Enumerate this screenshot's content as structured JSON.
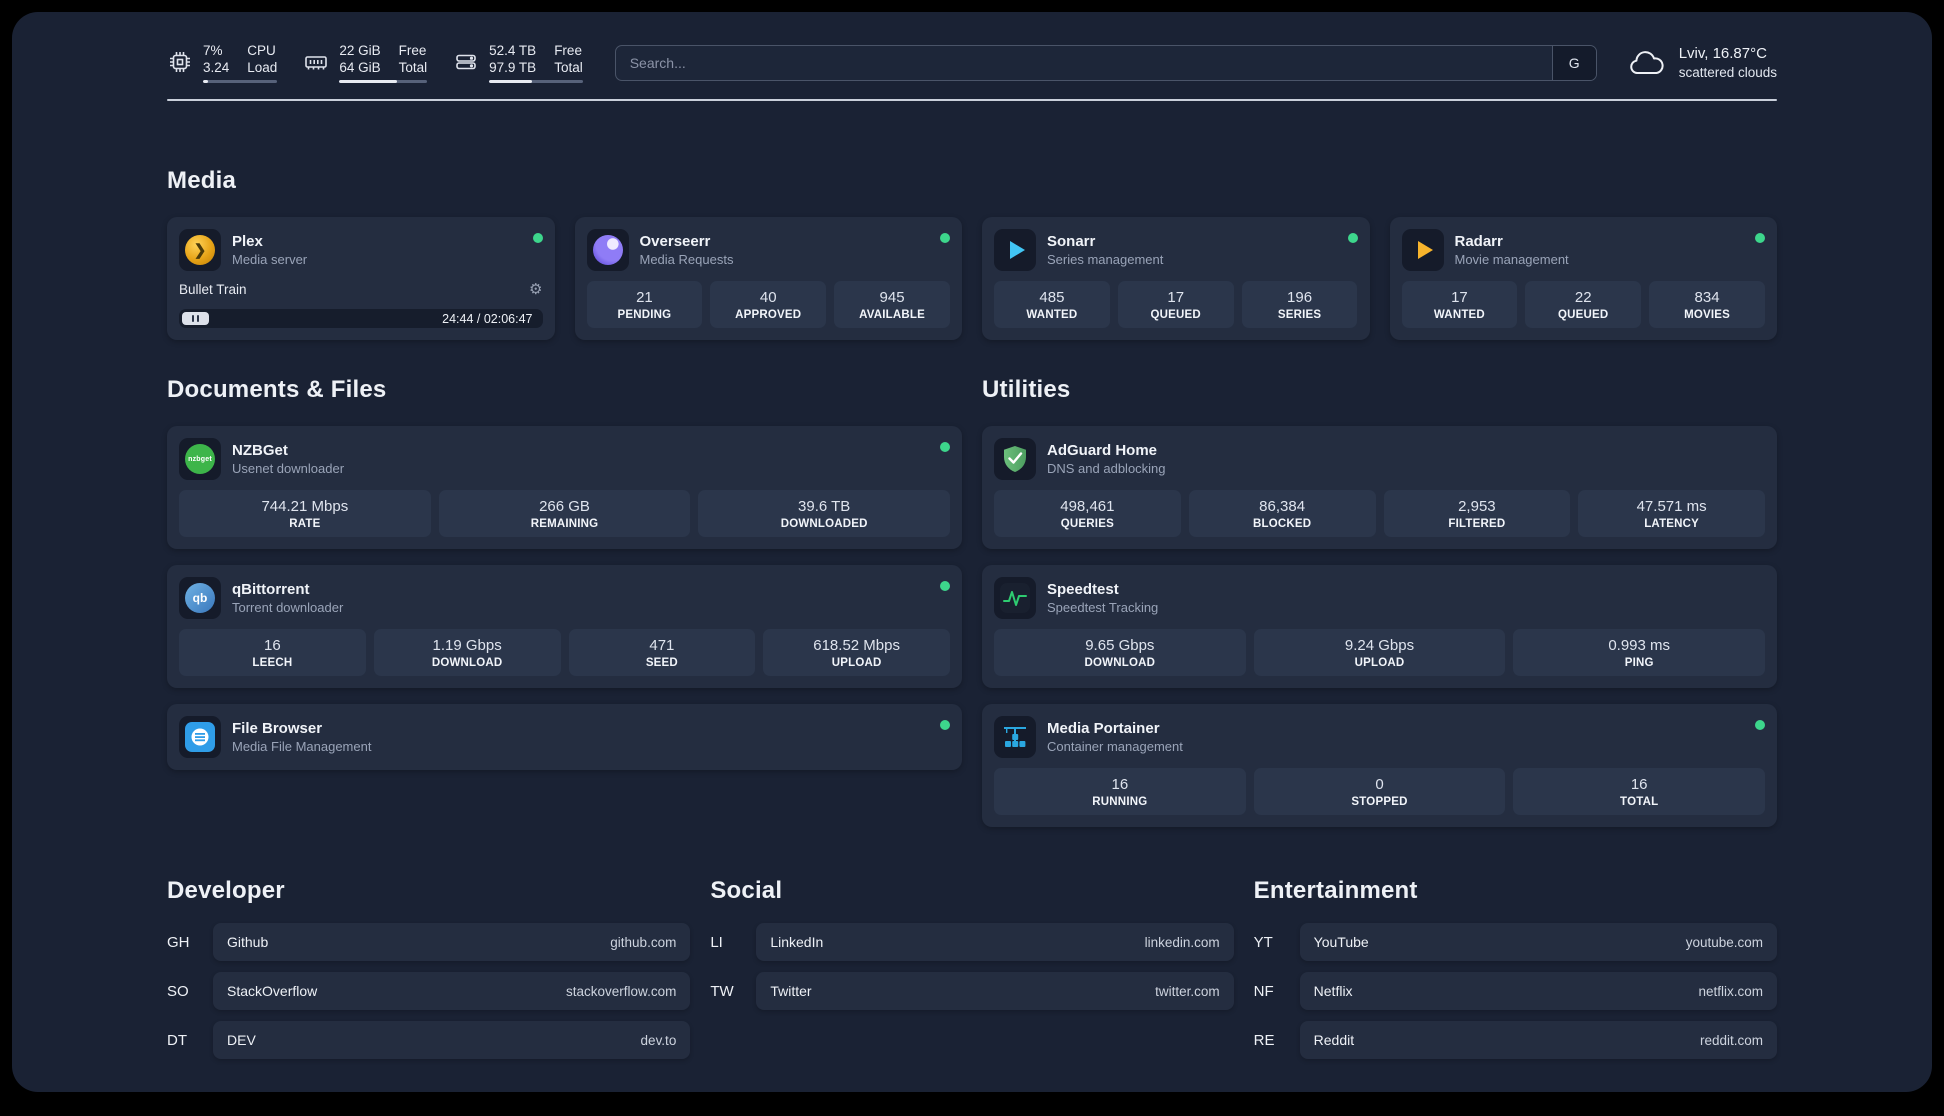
{
  "topbar": {
    "cpu": {
      "value_top": "7%",
      "value_bottom": "3.24",
      "label_top": "CPU",
      "label_bottom": "Load",
      "bar_percent": 7
    },
    "ram": {
      "value_top": "22 GiB",
      "value_bottom": "64 GiB",
      "label_top": "Free",
      "label_bottom": "Total",
      "bar_percent": 66
    },
    "disk": {
      "value_top": "52.4 TB",
      "value_bottom": "97.9 TB",
      "label_top": "Free",
      "label_bottom": "Total",
      "bar_percent": 46
    },
    "search": {
      "placeholder": "Search...",
      "button_label": "G"
    },
    "weather": {
      "location": "Lviv, 16.87°C",
      "condition": "scattered clouds"
    }
  },
  "sections": {
    "media": {
      "title": "Media",
      "plex": {
        "name": "Plex",
        "subtitle": "Media server",
        "now_playing": "Bullet Train",
        "time": "24:44 / 02:06:47"
      },
      "overseerr": {
        "name": "Overseerr",
        "subtitle": "Media Requests",
        "stats": [
          {
            "value": "21",
            "label": "PENDING"
          },
          {
            "value": "40",
            "label": "APPROVED"
          },
          {
            "value": "945",
            "label": "AVAILABLE"
          }
        ]
      },
      "sonarr": {
        "name": "Sonarr",
        "subtitle": "Series management",
        "stats": [
          {
            "value": "485",
            "label": "WANTED"
          },
          {
            "value": "17",
            "label": "QUEUED"
          },
          {
            "value": "196",
            "label": "SERIES"
          }
        ]
      },
      "radarr": {
        "name": "Radarr",
        "subtitle": "Movie management",
        "stats": [
          {
            "value": "17",
            "label": "WANTED"
          },
          {
            "value": "22",
            "label": "QUEUED"
          },
          {
            "value": "834",
            "label": "MOVIES"
          }
        ]
      }
    },
    "files": {
      "title": "Documents & Files",
      "nzbget": {
        "name": "NZBGet",
        "subtitle": "Usenet downloader",
        "stats": [
          {
            "value": "744.21 Mbps",
            "label": "RATE"
          },
          {
            "value": "266 GB",
            "label": "REMAINING"
          },
          {
            "value": "39.6 TB",
            "label": "DOWNLOADED"
          }
        ]
      },
      "qbittorrent": {
        "name": "qBittorrent",
        "subtitle": "Torrent downloader",
        "stats": [
          {
            "value": "16",
            "label": "LEECH"
          },
          {
            "value": "1.19 Gbps",
            "label": "DOWNLOAD"
          },
          {
            "value": "471",
            "label": "SEED"
          },
          {
            "value": "618.52 Mbps",
            "label": "UPLOAD"
          }
        ]
      },
      "filebrowser": {
        "name": "File Browser",
        "subtitle": "Media File Management"
      }
    },
    "utilities": {
      "title": "Utilities",
      "adguard": {
        "name": "AdGuard Home",
        "subtitle": "DNS and adblocking",
        "stats": [
          {
            "value": "498,461",
            "label": "QUERIES"
          },
          {
            "value": "86,384",
            "label": "BLOCKED"
          },
          {
            "value": "2,953",
            "label": "FILTERED"
          },
          {
            "value": "47.571 ms",
            "label": "LATENCY"
          }
        ]
      },
      "speedtest": {
        "name": "Speedtest",
        "subtitle": "Speedtest Tracking",
        "stats": [
          {
            "value": "9.65 Gbps",
            "label": "DOWNLOAD"
          },
          {
            "value": "9.24 Gbps",
            "label": "UPLOAD"
          },
          {
            "value": "0.993 ms",
            "label": "PING"
          }
        ]
      },
      "portainer": {
        "name": "Media Portainer",
        "subtitle": "Container management",
        "stats": [
          {
            "value": "16",
            "label": "RUNNING"
          },
          {
            "value": "0",
            "label": "STOPPED"
          },
          {
            "value": "16",
            "label": "TOTAL"
          }
        ]
      }
    }
  },
  "bookmarks": {
    "developer": {
      "title": "Developer",
      "items": [
        {
          "abbr": "GH",
          "name": "Github",
          "domain": "github.com"
        },
        {
          "abbr": "SO",
          "name": "StackOverflow",
          "domain": "stackoverflow.com"
        },
        {
          "abbr": "DT",
          "name": "DEV",
          "domain": "dev.to"
        }
      ]
    },
    "social": {
      "title": "Social",
      "items": [
        {
          "abbr": "LI",
          "name": "LinkedIn",
          "domain": "linkedin.com"
        },
        {
          "abbr": "TW",
          "name": "Twitter",
          "domain": "twitter.com"
        }
      ]
    },
    "entertainment": {
      "title": "Entertainment",
      "items": [
        {
          "abbr": "YT",
          "name": "YouTube",
          "domain": "youtube.com"
        },
        {
          "abbr": "NF",
          "name": "Netflix",
          "domain": "netflix.com"
        },
        {
          "abbr": "RE",
          "name": "Reddit",
          "domain": "reddit.com"
        }
      ]
    }
  },
  "colors": {
    "status_online": "#3dd68c",
    "plex": "#e6a317",
    "overseerr": "#8f7cf6",
    "sonarr": "#42c6f5",
    "radarr": "#f7b42c",
    "nzbget": "#3db54a",
    "qbittorrent": "#3a78bd",
    "filebrowser": "#2f9de8",
    "adguard": "#5fb370",
    "speedtest": "#2ecc71",
    "portainer": "#2aa7e0"
  }
}
